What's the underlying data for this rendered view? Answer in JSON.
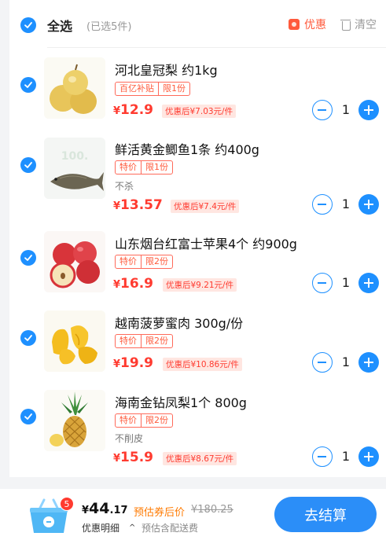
{
  "header": {
    "select_all": "全选",
    "selected_count": "(已选5件)",
    "coupon_label": "优惠",
    "clear_label": "清空"
  },
  "items": [
    {
      "title": "河北皇冠梨 约1kg",
      "tags": [
        "百亿补贴",
        "限1份"
      ],
      "note": "",
      "price_currency": "¥",
      "price": "12.9",
      "after_discount": "优惠后¥7.03元/件",
      "qty": "1",
      "image": "pear"
    },
    {
      "title": "鲜活黄金鲫鱼1条 约400g",
      "tags": [
        "特价",
        "限1份"
      ],
      "note": "不杀",
      "price_currency": "¥",
      "price": "13.57",
      "after_discount": "优惠后¥7.4元/件",
      "qty": "1",
      "image": "fish"
    },
    {
      "title": "山东烟台红富士苹果4个 约900g",
      "tags": [
        "特价",
        "限2份"
      ],
      "note": "",
      "price_currency": "¥",
      "price": "16.9",
      "after_discount": "优惠后¥9.21元/件",
      "qty": "1",
      "image": "apple"
    },
    {
      "title": "越南菠萝蜜肉 300g/份",
      "tags": [
        "特价",
        "限2份"
      ],
      "note": "",
      "price_currency": "¥",
      "price": "19.9",
      "after_discount": "优惠后¥10.86元/件",
      "qty": "1",
      "image": "jackfruit"
    },
    {
      "title": "海南金钻凤梨1个 800g",
      "tags": [
        "特价",
        "限2份"
      ],
      "note": "不削皮",
      "price_currency": "¥",
      "price": "15.9",
      "after_discount": "优惠后¥8.67元/件",
      "qty": "1",
      "image": "pineapple"
    }
  ],
  "footer": {
    "cart_badge": "5",
    "total_currency": "¥",
    "total_int": "44",
    "total_dec": ".17",
    "estimate_label": "预估券后价",
    "original_price": "¥180.25",
    "detail_label": "优惠明细",
    "estimate_sub": "预估含配送费",
    "checkout_label": "去结算"
  },
  "colors": {
    "accent_blue": "#1e90ff",
    "price_red": "#ff3b30",
    "coupon_orange": "#ff5a3c",
    "estimate_orange": "#ff7a00"
  }
}
